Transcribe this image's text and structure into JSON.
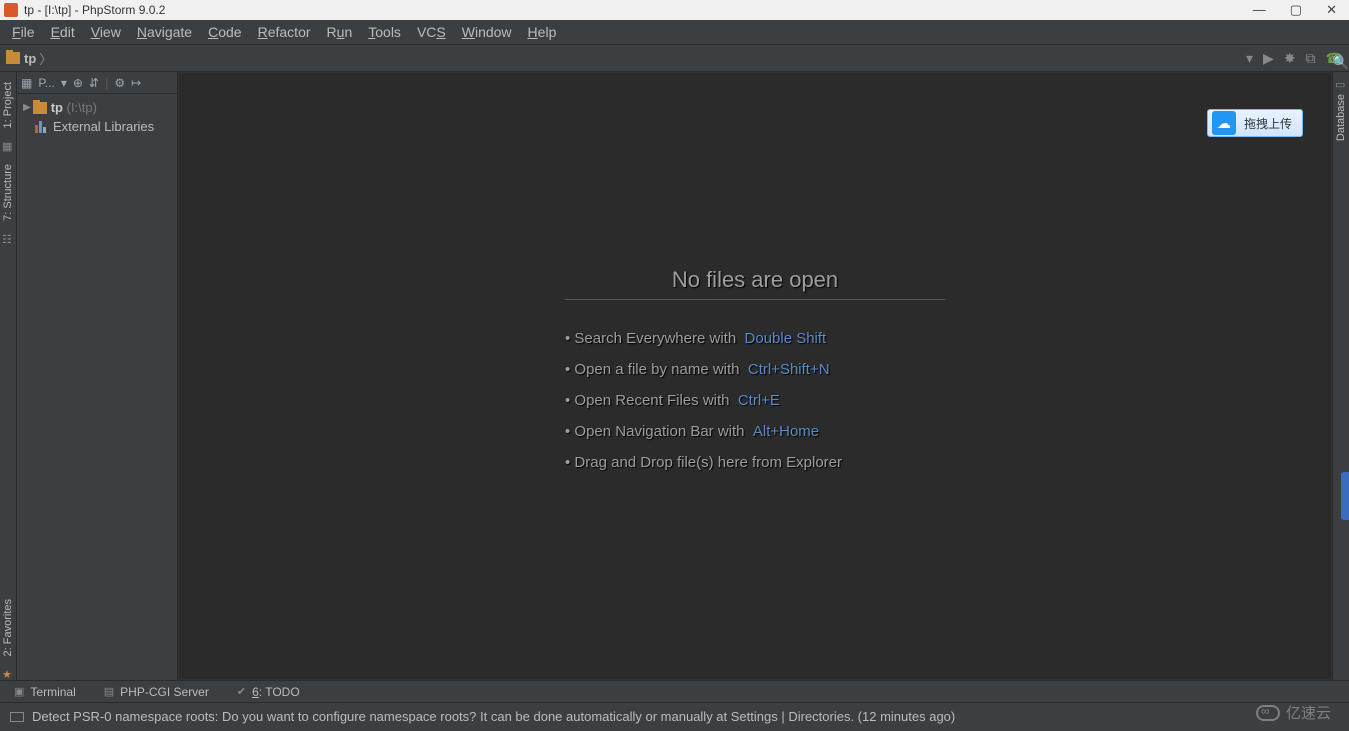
{
  "window": {
    "title": "tp - [I:\\tp] - PhpStorm 9.0.2"
  },
  "menu": [
    "File",
    "Edit",
    "View",
    "Navigate",
    "Code",
    "Refactor",
    "Run",
    "Tools",
    "VCS",
    "Window",
    "Help"
  ],
  "breadcrumb": {
    "root": "tp"
  },
  "project": {
    "title": "P...",
    "root_name": "tp",
    "root_path": "(I:\\tp)",
    "external_libs": "External Libraries"
  },
  "welcome": {
    "heading": "No files are open",
    "hints": [
      {
        "text": "Search Everywhere with",
        "key": "Double Shift"
      },
      {
        "text": "Open a file by name with",
        "key": "Ctrl+Shift+N"
      },
      {
        "text": "Open Recent Files with",
        "key": "Ctrl+E"
      },
      {
        "text": "Open Navigation Bar with",
        "key": "Alt+Home"
      },
      {
        "text": "Drag and Drop file(s) here from Explorer",
        "key": ""
      }
    ]
  },
  "upload_badge": "拖拽上传",
  "left_tools": [
    "1: Project",
    "7: Structure",
    "2: Favorites"
  ],
  "right_tools": [
    "Database"
  ],
  "bottom": {
    "terminal": "Terminal",
    "php_cgi": "PHP-CGI Server",
    "todo_prefix": "6",
    "todo_label": ": TODO"
  },
  "status": {
    "message": "Detect PSR-0 namespace roots: Do you want to configure namespace roots? It can be done automatically or manually at Settings | Directories. (12 minutes ago)"
  },
  "brand": "亿速云"
}
